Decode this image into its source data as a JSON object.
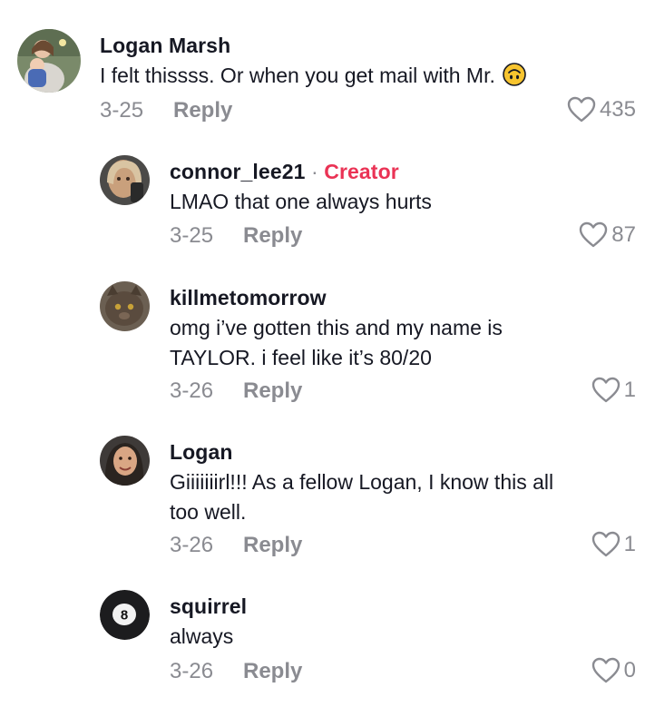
{
  "colors": {
    "creator": "#ea3355",
    "meta": "#8a8b91",
    "text": "#161823"
  },
  "comments": [
    {
      "username": "Logan Marsh",
      "text_lines": [
        "I felt thissss. Or when you get mail with Mr."
      ],
      "emoji": "upside-down-face",
      "date": "3-25",
      "reply_label": "Reply",
      "likes": "435"
    },
    {
      "username": "connor_lee21",
      "creator_separator": "·",
      "creator_label": "Creator",
      "text_lines": [
        "LMAO that one always hurts"
      ],
      "date": "3-25",
      "reply_label": "Reply",
      "likes": "87"
    },
    {
      "username": "killmetomorrow",
      "text_lines": [
        "omg i’ve gotten this and my name is",
        "TAYLOR. i feel like it’s 80/20"
      ],
      "date": "3-26",
      "reply_label": "Reply",
      "likes": "1"
    },
    {
      "username": "Logan",
      "text_lines": [
        "Giiiiiiirl!!! As a fellow Logan, I know this all",
        "too well."
      ],
      "date": "3-26",
      "reply_label": "Reply",
      "likes": "1"
    },
    {
      "username": "squirrel",
      "text_lines": [
        "always"
      ],
      "date": "3-26",
      "reply_label": "Reply",
      "likes": "0"
    }
  ]
}
